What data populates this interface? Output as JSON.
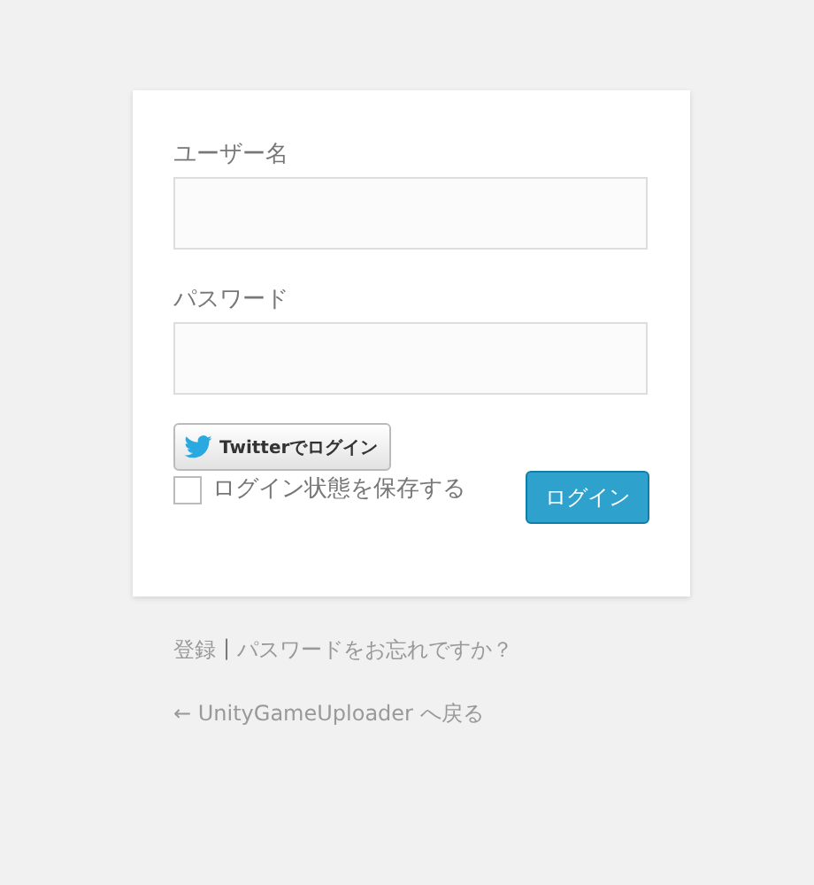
{
  "form": {
    "username_label": "ユーザー名",
    "password_label": "パスワード",
    "twitter_button": "Twitterでログイン",
    "remember": {
      "label": "ログイン状態を保存する",
      "checked": false
    },
    "submit": "ログイン"
  },
  "links": {
    "register": "登録",
    "separator": "|",
    "lost_password": "パスワードをお忘れですか？"
  },
  "back_link": "← UnityGameUploader へ戻る"
}
